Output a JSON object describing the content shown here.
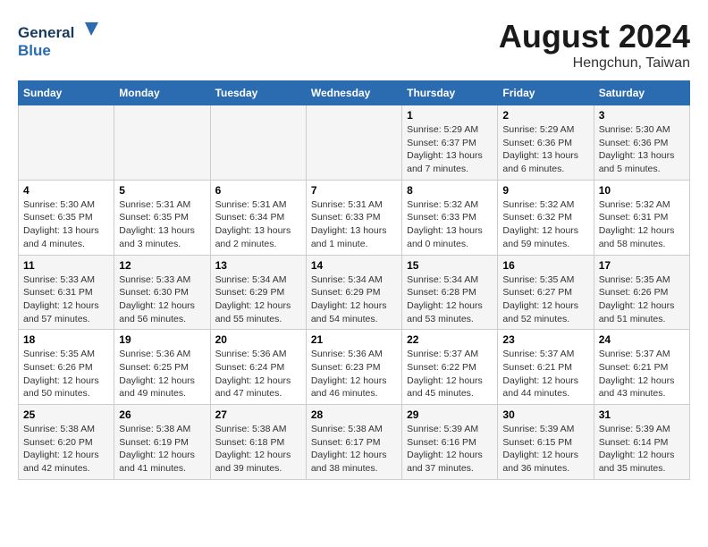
{
  "header": {
    "logo_line1": "General",
    "logo_line2": "Blue",
    "month_year": "August 2024",
    "location": "Hengchun, Taiwan"
  },
  "days_of_week": [
    "Sunday",
    "Monday",
    "Tuesday",
    "Wednesday",
    "Thursday",
    "Friday",
    "Saturday"
  ],
  "weeks": [
    [
      {
        "day": "",
        "detail": ""
      },
      {
        "day": "",
        "detail": ""
      },
      {
        "day": "",
        "detail": ""
      },
      {
        "day": "",
        "detail": ""
      },
      {
        "day": "1",
        "detail": "Sunrise: 5:29 AM\nSunset: 6:37 PM\nDaylight: 13 hours\nand 7 minutes."
      },
      {
        "day": "2",
        "detail": "Sunrise: 5:29 AM\nSunset: 6:36 PM\nDaylight: 13 hours\nand 6 minutes."
      },
      {
        "day": "3",
        "detail": "Sunrise: 5:30 AM\nSunset: 6:36 PM\nDaylight: 13 hours\nand 5 minutes."
      }
    ],
    [
      {
        "day": "4",
        "detail": "Sunrise: 5:30 AM\nSunset: 6:35 PM\nDaylight: 13 hours\nand 4 minutes."
      },
      {
        "day": "5",
        "detail": "Sunrise: 5:31 AM\nSunset: 6:35 PM\nDaylight: 13 hours\nand 3 minutes."
      },
      {
        "day": "6",
        "detail": "Sunrise: 5:31 AM\nSunset: 6:34 PM\nDaylight: 13 hours\nand 2 minutes."
      },
      {
        "day": "7",
        "detail": "Sunrise: 5:31 AM\nSunset: 6:33 PM\nDaylight: 13 hours\nand 1 minute."
      },
      {
        "day": "8",
        "detail": "Sunrise: 5:32 AM\nSunset: 6:33 PM\nDaylight: 13 hours\nand 0 minutes."
      },
      {
        "day": "9",
        "detail": "Sunrise: 5:32 AM\nSunset: 6:32 PM\nDaylight: 12 hours\nand 59 minutes."
      },
      {
        "day": "10",
        "detail": "Sunrise: 5:32 AM\nSunset: 6:31 PM\nDaylight: 12 hours\nand 58 minutes."
      }
    ],
    [
      {
        "day": "11",
        "detail": "Sunrise: 5:33 AM\nSunset: 6:31 PM\nDaylight: 12 hours\nand 57 minutes."
      },
      {
        "day": "12",
        "detail": "Sunrise: 5:33 AM\nSunset: 6:30 PM\nDaylight: 12 hours\nand 56 minutes."
      },
      {
        "day": "13",
        "detail": "Sunrise: 5:34 AM\nSunset: 6:29 PM\nDaylight: 12 hours\nand 55 minutes."
      },
      {
        "day": "14",
        "detail": "Sunrise: 5:34 AM\nSunset: 6:29 PM\nDaylight: 12 hours\nand 54 minutes."
      },
      {
        "day": "15",
        "detail": "Sunrise: 5:34 AM\nSunset: 6:28 PM\nDaylight: 12 hours\nand 53 minutes."
      },
      {
        "day": "16",
        "detail": "Sunrise: 5:35 AM\nSunset: 6:27 PM\nDaylight: 12 hours\nand 52 minutes."
      },
      {
        "day": "17",
        "detail": "Sunrise: 5:35 AM\nSunset: 6:26 PM\nDaylight: 12 hours\nand 51 minutes."
      }
    ],
    [
      {
        "day": "18",
        "detail": "Sunrise: 5:35 AM\nSunset: 6:26 PM\nDaylight: 12 hours\nand 50 minutes."
      },
      {
        "day": "19",
        "detail": "Sunrise: 5:36 AM\nSunset: 6:25 PM\nDaylight: 12 hours\nand 49 minutes."
      },
      {
        "day": "20",
        "detail": "Sunrise: 5:36 AM\nSunset: 6:24 PM\nDaylight: 12 hours\nand 47 minutes."
      },
      {
        "day": "21",
        "detail": "Sunrise: 5:36 AM\nSunset: 6:23 PM\nDaylight: 12 hours\nand 46 minutes."
      },
      {
        "day": "22",
        "detail": "Sunrise: 5:37 AM\nSunset: 6:22 PM\nDaylight: 12 hours\nand 45 minutes."
      },
      {
        "day": "23",
        "detail": "Sunrise: 5:37 AM\nSunset: 6:21 PM\nDaylight: 12 hours\nand 44 minutes."
      },
      {
        "day": "24",
        "detail": "Sunrise: 5:37 AM\nSunset: 6:21 PM\nDaylight: 12 hours\nand 43 minutes."
      }
    ],
    [
      {
        "day": "25",
        "detail": "Sunrise: 5:38 AM\nSunset: 6:20 PM\nDaylight: 12 hours\nand 42 minutes."
      },
      {
        "day": "26",
        "detail": "Sunrise: 5:38 AM\nSunset: 6:19 PM\nDaylight: 12 hours\nand 41 minutes."
      },
      {
        "day": "27",
        "detail": "Sunrise: 5:38 AM\nSunset: 6:18 PM\nDaylight: 12 hours\nand 39 minutes."
      },
      {
        "day": "28",
        "detail": "Sunrise: 5:38 AM\nSunset: 6:17 PM\nDaylight: 12 hours\nand 38 minutes."
      },
      {
        "day": "29",
        "detail": "Sunrise: 5:39 AM\nSunset: 6:16 PM\nDaylight: 12 hours\nand 37 minutes."
      },
      {
        "day": "30",
        "detail": "Sunrise: 5:39 AM\nSunset: 6:15 PM\nDaylight: 12 hours\nand 36 minutes."
      },
      {
        "day": "31",
        "detail": "Sunrise: 5:39 AM\nSunset: 6:14 PM\nDaylight: 12 hours\nand 35 minutes."
      }
    ]
  ]
}
